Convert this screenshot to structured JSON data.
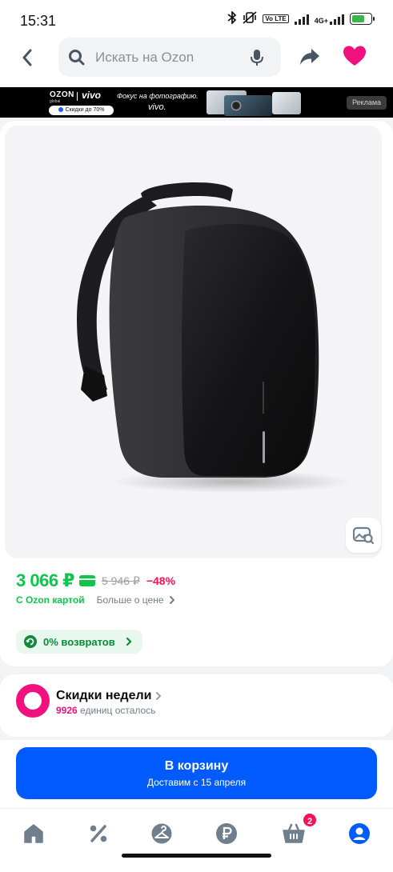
{
  "status_bar": {
    "time": "15:31",
    "volte": "Vo LTE",
    "network": "4G+",
    "icons": [
      "bluetooth-icon",
      "vibrate-icon",
      "volte-icon",
      "signal-icon",
      "signal-4g-icon",
      "battery-icon"
    ]
  },
  "header": {
    "search_placeholder": "Искать на Ozon",
    "icons": [
      "back-arrow-icon",
      "search-icon",
      "microphone-icon",
      "share-icon",
      "heart-icon"
    ],
    "heart_color": "#f1117e"
  },
  "banner": {
    "brand": "OZON",
    "brand_sub": "global",
    "partner": "vivo",
    "pill": "Скидки до 70%",
    "text1": "Фокус на фотографию.",
    "text2": "vivo.",
    "ad_label": "Реклама"
  },
  "product": {
    "price": "3 066 ₽",
    "old_price": "5 946 ₽",
    "discount": "−48%",
    "ozon_card_label": "С Ozon картой",
    "more_price_label": "Больше о цене",
    "returns_label": "0% возвратов",
    "price_color": "#10c44c",
    "discount_color": "#f91155"
  },
  "weekly": {
    "title": "Скидки недели",
    "count": "9926",
    "count_suffix": "единиц осталось"
  },
  "cart": {
    "label": "В корзину",
    "delivery": "Доставим с 15 апреля",
    "color": "#005bff"
  },
  "nav": {
    "items": [
      "home-icon",
      "percent-icon",
      "hanger-icon",
      "ruble-icon",
      "basket-icon",
      "profile-icon"
    ],
    "basket_badge": "2",
    "active_color": "#005bff"
  }
}
